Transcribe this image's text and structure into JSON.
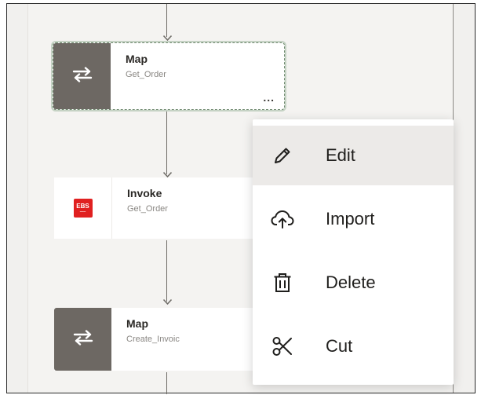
{
  "flow": {
    "nodes": [
      {
        "type": "Map",
        "name": "Get_Order",
        "icon": "map-transform-icon",
        "selected": true,
        "more_label": "..."
      },
      {
        "type": "Invoke",
        "name": "Get_Order",
        "icon": "ebs-adapter-icon",
        "badge_text": "EBS"
      },
      {
        "type": "Map",
        "name": "Create_Invoic",
        "icon": "map-transform-icon"
      }
    ]
  },
  "context_menu": {
    "items": [
      {
        "label": "Edit",
        "icon": "pencil-icon",
        "highlighted": true
      },
      {
        "label": "Import",
        "icon": "cloud-upload-icon"
      },
      {
        "label": "Delete",
        "icon": "trash-icon"
      },
      {
        "label": "Cut",
        "icon": "scissors-icon"
      }
    ]
  },
  "colors": {
    "map_icon_bg": "#6d6863",
    "ebs_badge": "#e02020",
    "selection_outline": "#6f8a6f",
    "menu_hover": "#eceae8"
  }
}
